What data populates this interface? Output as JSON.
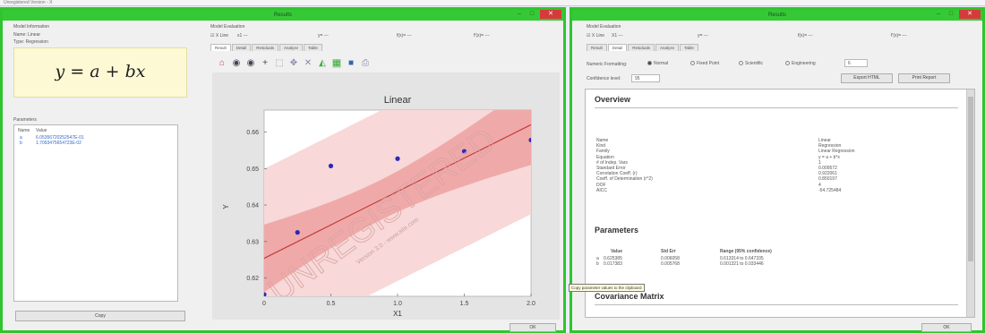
{
  "topstrip": {
    "text": "Unregistered Version - X"
  },
  "left_window": {
    "title": "Results",
    "model_information": {
      "heading": "Model Information",
      "name": "Name: Linear",
      "type": "Type: Regression",
      "equation": "y = a + bx",
      "parameters_heading": "Parameters",
      "param_headers": [
        "Name",
        "Value"
      ],
      "params": [
        {
          "name": "a",
          "value": "6.05356720252547E-01"
        },
        {
          "name": "b",
          "value": "1.7093475654723E-02"
        }
      ],
      "copy_label": "Copy"
    },
    "model_evaluation": {
      "heading": "Model Evaluation",
      "x_checkbox": "X Line",
      "x_value": "x1 ---",
      "y_value": "y= ---",
      "fit_value": "f(x)= ---",
      "fit2_value": "f'(x)= ---"
    },
    "tabs": [
      "Result",
      "Detail",
      "Residuals",
      "Analyze",
      "Table"
    ],
    "ok_label": "OK"
  },
  "chart_data": {
    "type": "scatter",
    "title": "Linear",
    "xlabel": "X1",
    "ylabel": "Y",
    "xlim": [
      0,
      2.0
    ],
    "ylim": [
      0.615,
      0.666
    ],
    "xticks": [
      "0",
      "0.5",
      "1.0",
      "1.5",
      "2.0"
    ],
    "yticks": [
      "0.62",
      "0.63",
      "0.64",
      "0.65",
      "0.66"
    ],
    "points": [
      {
        "x": 0.0,
        "y": 0.6155
      },
      {
        "x": 0.25,
        "y": 0.6325
      },
      {
        "x": 0.5,
        "y": 0.6507
      },
      {
        "x": 1.0,
        "y": 0.6527
      },
      {
        "x": 1.5,
        "y": 0.6547
      },
      {
        "x": 2.0,
        "y": 0.6578
      }
    ],
    "fit_line": {
      "a": 0.6254,
      "b": 0.0183
    },
    "watermark": "UNREGISTERED",
    "watermark_sub": "Version 3.0 - www.site.com"
  },
  "right_window": {
    "title": "Results",
    "model_evaluation": {
      "heading": "Model Evaluation",
      "x_checkbox": "X Line",
      "x_value": "X1 ---",
      "y_value": "y= ---",
      "fit_value": "f(x)= ---",
      "fit2_value": "f'(x)= ---"
    },
    "tabs": [
      "Result",
      "Detail",
      "Residuals",
      "Analyze",
      "Table"
    ],
    "numeric_formatting": {
      "label": "Numeric Formatting:",
      "options": [
        "Normal",
        "Fixed Point",
        "Scientific",
        "Engineering"
      ],
      "selected": "Normal",
      "digits": "6"
    },
    "confidence": {
      "label": "Confidence level:",
      "value": "95"
    },
    "export_label": "Export HTML",
    "print_label": "Print Report",
    "overview": {
      "title": "Overview",
      "rows": [
        {
          "k": "Name",
          "v": "Linear"
        },
        {
          "k": "Kind",
          "v": "Regression"
        },
        {
          "k": "Family",
          "v": "Linear Regression"
        },
        {
          "k": "Equation",
          "v": "y = a + b*x"
        },
        {
          "k": "# of Indep. Vars",
          "v": "1"
        },
        {
          "k": "Standard Error",
          "v": "0.009572"
        },
        {
          "k": "Correlation Coeff. (r)",
          "v": "0.922061"
        },
        {
          "k": "Coeff. of Determination (r^2)",
          "v": "0.850197"
        },
        {
          "k": "DOF",
          "v": "4"
        },
        {
          "k": "AICC",
          "v": "-54.725484"
        }
      ]
    },
    "parameters": {
      "title": "Parameters",
      "headers": [
        "Value",
        "Std Err",
        "Range (95% confidence)"
      ],
      "rows": [
        {
          "name": "a",
          "value": "0.625385",
          "stderr": "0.006058",
          "range": "0.613314 to 0.647335"
        },
        {
          "name": "b",
          "value": "0.017383",
          "stderr": "0.005768",
          "range": "0.001321 to 0.033446"
        }
      ]
    },
    "tooltip": "Copy parameter values to the clipboard",
    "covariance_title": "Covariance Matrix",
    "ok_label": "OK"
  }
}
